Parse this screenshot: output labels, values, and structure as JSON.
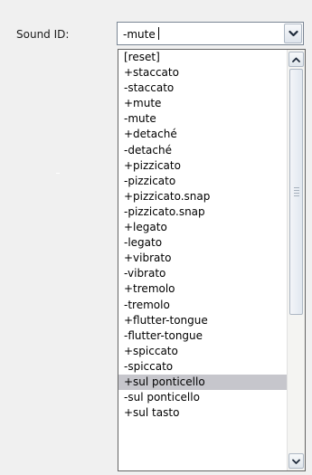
{
  "form": {
    "label": "Sound ID:",
    "combo_value": "-mute"
  },
  "dropdown": {
    "highlighted_item": "+sul ponticello",
    "items": [
      "[reset]",
      "+staccato",
      "-staccato",
      "+mute",
      "-mute",
      "+detaché",
      "-detaché",
      "+pizzicato",
      "-pizzicato",
      "+pizzicato.snap",
      "-pizzicato.snap",
      "+legato",
      "-legato",
      "+vibrato",
      "-vibrato",
      "+tremolo",
      "-tremolo",
      "+flutter-tongue",
      "-flutter-tongue",
      "+spiccato",
      "-spiccato",
      "+sul ponticello",
      "-sul ponticello",
      "+sul tasto"
    ]
  },
  "icons": {
    "combo_button": "chevron-down-icon",
    "scroll_up": "scroll-up-arrow-icon",
    "scroll_down": "scroll-down-arrow-icon",
    "thumb_grip": "grip-icon"
  },
  "colors": {
    "panel_background": "#f0f0f0",
    "highlight": "#c6c6cc"
  }
}
